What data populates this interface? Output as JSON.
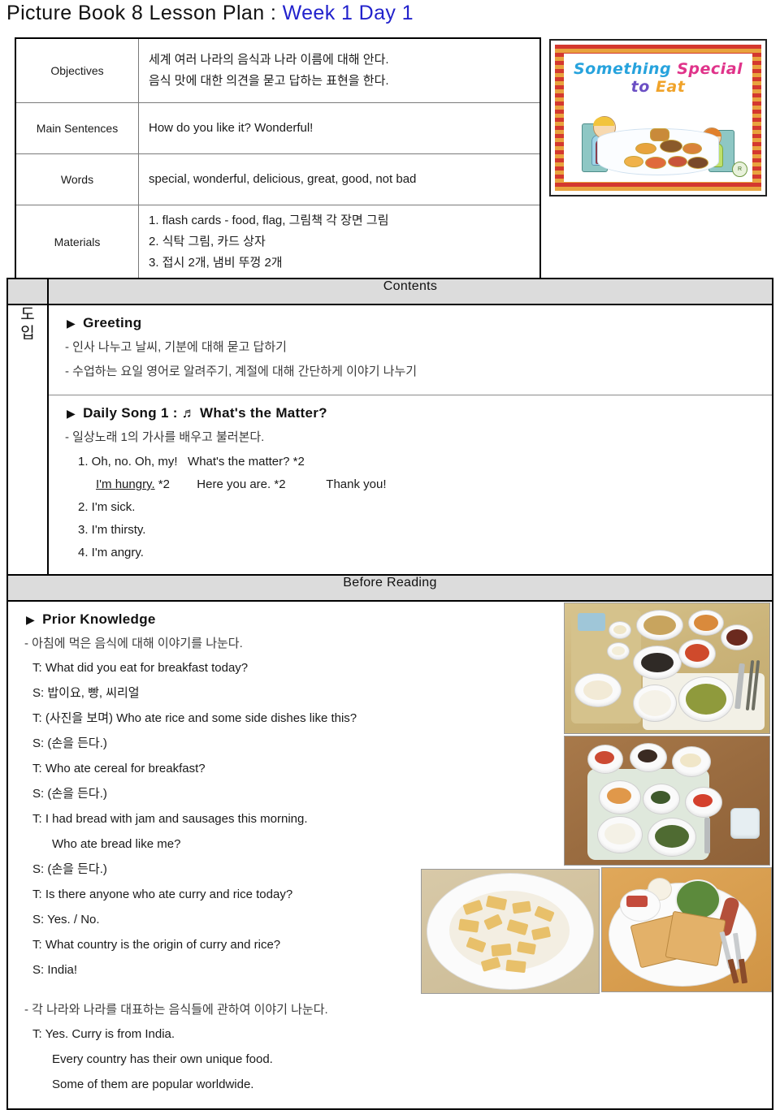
{
  "document": {
    "title_main": "Picture Book 8  Lesson Plan : ",
    "title_week": "Week 1 Day 1"
  },
  "info_table": {
    "rows": [
      {
        "label": "Objectives",
        "lines": [
          "세계 여러 나라의 음식과 나라 이름에 대해 안다.",
          "음식 맛에 대한 의견을 묻고 답하는 표현을 한다."
        ]
      },
      {
        "label": "Main Sentences",
        "lines": [
          "How do you like it? Wonderful!"
        ]
      },
      {
        "label": "Words",
        "lines": [
          "special, wonderful, delicious, great, good, not bad"
        ]
      },
      {
        "label": "Materials",
        "lines": [
          "1. flash cards - food, flag, 그림책 각 장면 그림",
          "2. 식탁 그림, 카드 상자",
          "3. 접시 2개, 냄비 뚜껑 2개"
        ]
      }
    ]
  },
  "book_cover": {
    "title_word1": "Something",
    "title_word2": "Special",
    "title_word3": "to",
    "title_word4": "Eat",
    "badge": "R",
    "alt": "picture book cover illustration of a man and a child at a table full of food"
  },
  "contents_section": {
    "band_label": "Contents",
    "stage_label_char1": "도",
    "stage_label_char2": "입",
    "greeting": {
      "heading": "Greeting",
      "notes": [
        "- 인사 나누고 날씨, 기분에 대해 묻고 답하기",
        "- 수업하는 요일 영어로 알려주기, 계절에 대해 간단하게 이야기 나누기"
      ]
    },
    "daily_song": {
      "heading": "Daily Song 1 : ♬ What's the Matter?",
      "note": "- 일상노래 1의 가사를 배우고 불러본다.",
      "lines": [
        "1. Oh, no. Oh, my!   What's the matter? *2",
        "2. I'm sick.",
        "3. I'm thirsty.",
        "4. I'm angry."
      ],
      "chorus_underlined": "I'm hungry.",
      "chorus_rest": " *2        Here you are. *2            Thank you!"
    }
  },
  "before_reading": {
    "band_label": "Before Reading",
    "prior_knowledge": {
      "heading": "Prior Knowledge",
      "note": "- 아침에 먹은 음식에 대해 이야기를 나눈다.",
      "dialogue": [
        {
          "text": "T: What did you eat for breakfast today?",
          "continuation": false
        },
        {
          "text": "S: 밥이요, 빵, 씨리얼",
          "continuation": false
        },
        {
          "text": "T: (사진을 보며) Who ate rice and some side dishes like this?",
          "continuation": false
        },
        {
          "text": "S: (손을 든다.)",
          "continuation": false
        },
        {
          "text": "T: Who ate cereal for breakfast?",
          "continuation": false
        },
        {
          "text": "S: (손을 든다.)",
          "continuation": false
        },
        {
          "text": "T: I had bread with jam and sausages this morning.",
          "continuation": false
        },
        {
          "text": "Who ate bread like me?",
          "continuation": true
        },
        {
          "text": "S: (손을 든다.)",
          "continuation": false
        },
        {
          "text": "T: Is there anyone who ate curry and rice today?",
          "continuation": false
        },
        {
          "text": "S: Yes. / No.",
          "continuation": false
        },
        {
          "text": "T: What country is the origin of curry and rice?",
          "continuation": false
        },
        {
          "text": "S: India!",
          "continuation": false
        }
      ]
    },
    "countries": {
      "note": "- 각 나라와 나라를 대표하는 음식들에 관하여 이야기 나눈다.",
      "dialogue": [
        {
          "text": "T: Yes. Curry is from India.",
          "continuation": false
        },
        {
          "text": "Every country has their own unique food.",
          "continuation": true
        },
        {
          "text": "Some of them are popular worldwide.",
          "continuation": true,
          "faded": true
        }
      ]
    }
  },
  "photos": [
    {
      "name": "korean-breakfast-tray-1",
      "alt": "Korean breakfast with rice, soup and side dishes"
    },
    {
      "name": "korean-breakfast-tray-2",
      "alt": "Korean meal with many small side dish bowls"
    },
    {
      "name": "cereal-bowl",
      "alt": "bowl of corn flakes with milk"
    },
    {
      "name": "western-breakfast",
      "alt": "toast, sausage, egg and salad plate"
    }
  ],
  "colors": {
    "title_accent": "#2222cc",
    "band_bg": "#dcdcdc",
    "border": "#000000"
  }
}
